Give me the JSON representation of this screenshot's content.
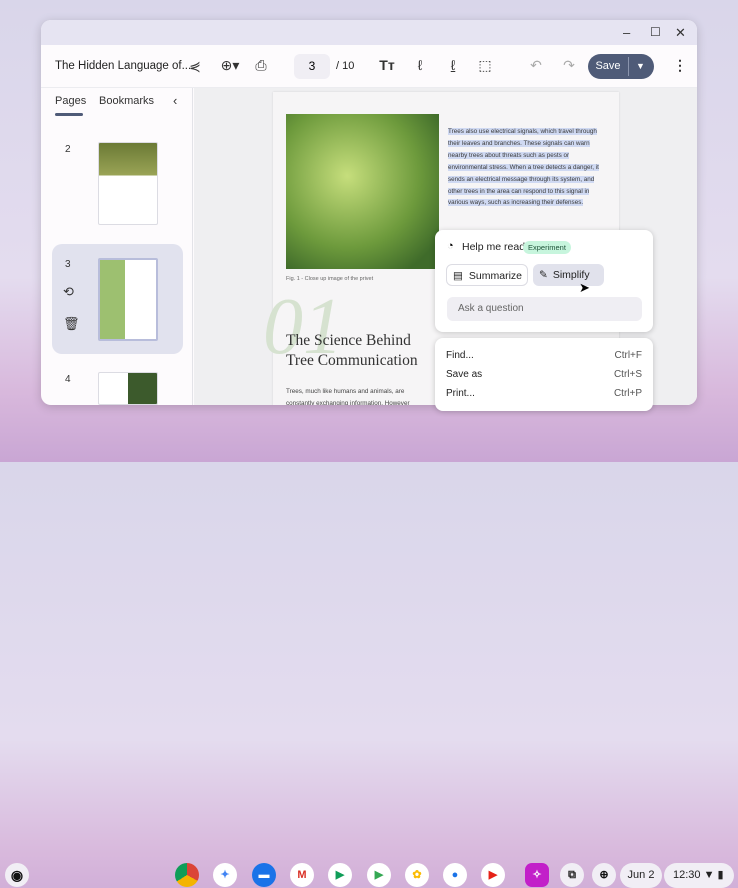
{
  "window": {
    "title": "The Hidden Language of...",
    "controls": {
      "minimize": "–",
      "maximize": "☐",
      "close": "✕"
    }
  },
  "toolbar": {
    "current_page": "3",
    "total_pages": "/ 10",
    "save_label": "Save"
  },
  "sidebar": {
    "tabs": [
      "Pages",
      "Bookmarks"
    ],
    "pages": [
      "2",
      "3",
      "4"
    ]
  },
  "document": {
    "selected_text": "Trees also use electrical signals, which travel through their leaves and branches. These signals can warn nearby trees about threats such as pests or environmental stress. When a tree detects a danger, it sends an electrical message through its system, and other trees in the area can respond to this signal in various ways, such as increasing their defenses.",
    "caption": "Fig. 1 - Close up image of the privet",
    "chapter_number": "01",
    "heading": "The Science Behind Tree Communication",
    "body": "Trees, much like humans and animals, are constantly exchanging information. However"
  },
  "help_me_read": {
    "title": "Help me read",
    "badge": "Experiment",
    "summarize": "Summarize",
    "simplify": "Simplify",
    "ask_placeholder": "Ask a question"
  },
  "context_menu": [
    {
      "label": "Find...",
      "shortcut": "Ctrl+F"
    },
    {
      "label": "Save as",
      "shortcut": "Ctrl+S"
    },
    {
      "label": "Print...",
      "shortcut": "Ctrl+P"
    }
  ],
  "shelf": {
    "date": "Jun 2",
    "time": "12:30"
  }
}
